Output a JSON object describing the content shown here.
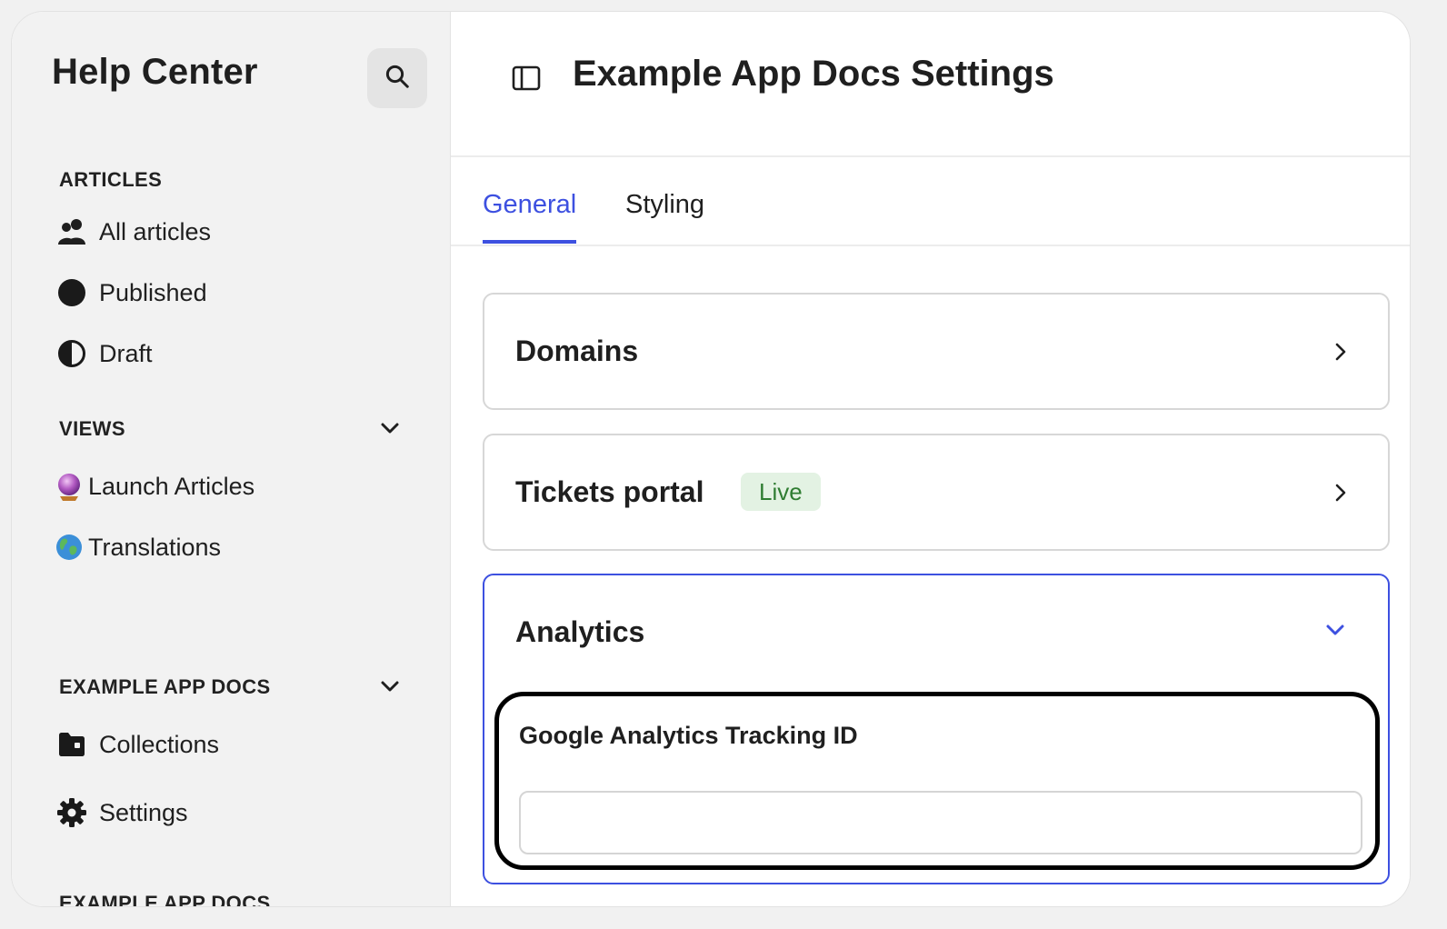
{
  "sidebar": {
    "title": "Help Center",
    "search_icon": "search-icon",
    "articles_section": {
      "header": "ARTICLES",
      "items": [
        {
          "label": "All articles",
          "icon": "people-icon"
        },
        {
          "label": "Published",
          "icon": "filled-circle-icon"
        },
        {
          "label": "Draft",
          "icon": "half-circle-icon"
        }
      ]
    },
    "views_section": {
      "header": "VIEWS",
      "items": [
        {
          "label": "Launch Articles",
          "icon": "crystal-ball-icon"
        },
        {
          "label": "Translations",
          "icon": "globe-icon"
        }
      ]
    },
    "docs_section": {
      "header": "EXAMPLE APP DOCS",
      "items": [
        {
          "label": "Collections",
          "icon": "folder-icon"
        },
        {
          "label": "Settings",
          "icon": "gear-icon"
        }
      ]
    },
    "cutoff_header": "EXAMPLE APP DOCS"
  },
  "header": {
    "title": "Example App Docs Settings",
    "toggle_icon": "sidebar-toggle-icon"
  },
  "tabs": [
    {
      "label": "General",
      "active": true
    },
    {
      "label": "Styling",
      "active": false
    }
  ],
  "cards": {
    "domains": {
      "title": "Domains"
    },
    "tickets": {
      "title": "Tickets portal",
      "badge": "Live"
    },
    "analytics": {
      "title": "Analytics",
      "field_label": "Google Analytics Tracking ID",
      "field_value": "",
      "field_placeholder": ""
    }
  },
  "colors": {
    "accent": "#3d50e0",
    "badge_bg": "#e3f2e3",
    "badge_text": "#2f7d32",
    "sidebar_bg": "#f2f2f2"
  }
}
